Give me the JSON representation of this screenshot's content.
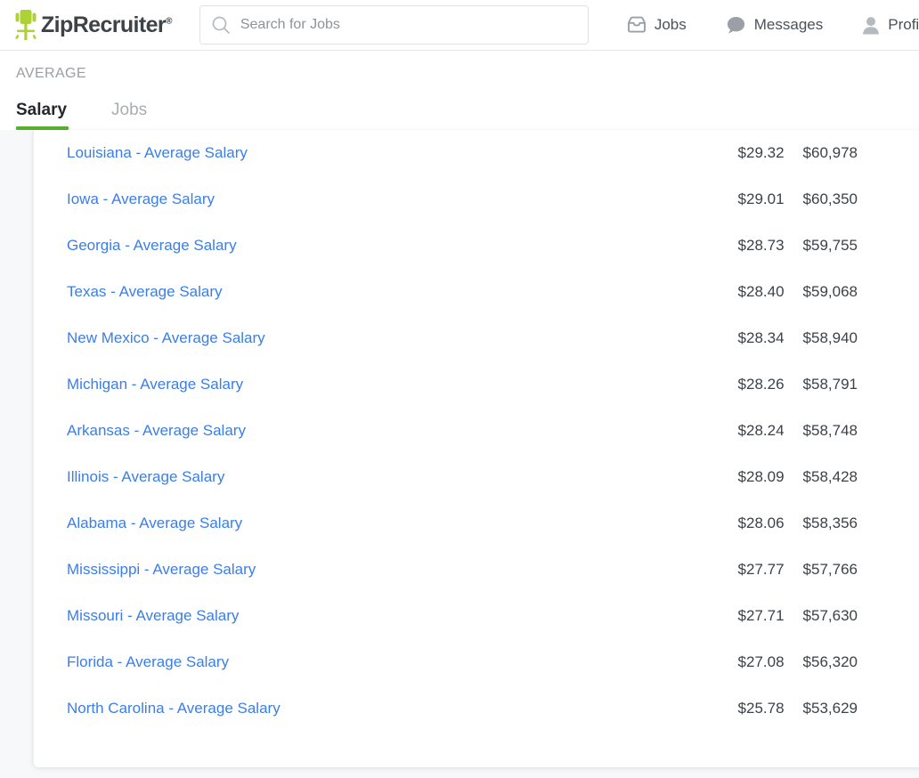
{
  "header": {
    "brand_name": "ZipRecruiter",
    "brand_registered": "®",
    "search": {
      "placeholder": "Search for Jobs",
      "value": ""
    },
    "nav": [
      {
        "label": "Jobs",
        "icon": "inbox-icon"
      },
      {
        "label": "Messages",
        "icon": "speech-bubble-icon"
      },
      {
        "label": "Profile",
        "icon": "person-icon"
      }
    ]
  },
  "section": {
    "eyebrow": "AVERAGE",
    "tabs": [
      {
        "label": "Salary",
        "active": true
      },
      {
        "label": "Jobs",
        "active": false
      }
    ]
  },
  "colors": {
    "brand_green": "#aed136",
    "tab_underline_green": "#57b02c",
    "link_blue": "#3b7ee8",
    "page_background": "#f7f8fa",
    "text_dark": "#3b4248",
    "text_muted": "#9b9fa3"
  },
  "table": {
    "rows": [
      {
        "name": "Louisiana - Average Salary",
        "hourly": "$29.32",
        "annual": "$60,978"
      },
      {
        "name": "Iowa - Average Salary",
        "hourly": "$29.01",
        "annual": "$60,350"
      },
      {
        "name": "Georgia - Average Salary",
        "hourly": "$28.73",
        "annual": "$59,755"
      },
      {
        "name": "Texas - Average Salary",
        "hourly": "$28.40",
        "annual": "$59,068"
      },
      {
        "name": "New Mexico - Average Salary",
        "hourly": "$28.34",
        "annual": "$58,940"
      },
      {
        "name": "Michigan - Average Salary",
        "hourly": "$28.26",
        "annual": "$58,791"
      },
      {
        "name": "Arkansas - Average Salary",
        "hourly": "$28.24",
        "annual": "$58,748"
      },
      {
        "name": "Illinois - Average Salary",
        "hourly": "$28.09",
        "annual": "$58,428"
      },
      {
        "name": "Alabama - Average Salary",
        "hourly": "$28.06",
        "annual": "$58,356"
      },
      {
        "name": "Mississippi - Average Salary",
        "hourly": "$27.77",
        "annual": "$57,766"
      },
      {
        "name": "Missouri - Average Salary",
        "hourly": "$27.71",
        "annual": "$57,630"
      },
      {
        "name": "Florida - Average Salary",
        "hourly": "$27.08",
        "annual": "$56,320"
      },
      {
        "name": "North Carolina - Average Salary",
        "hourly": "$25.78",
        "annual": "$53,629"
      }
    ]
  }
}
